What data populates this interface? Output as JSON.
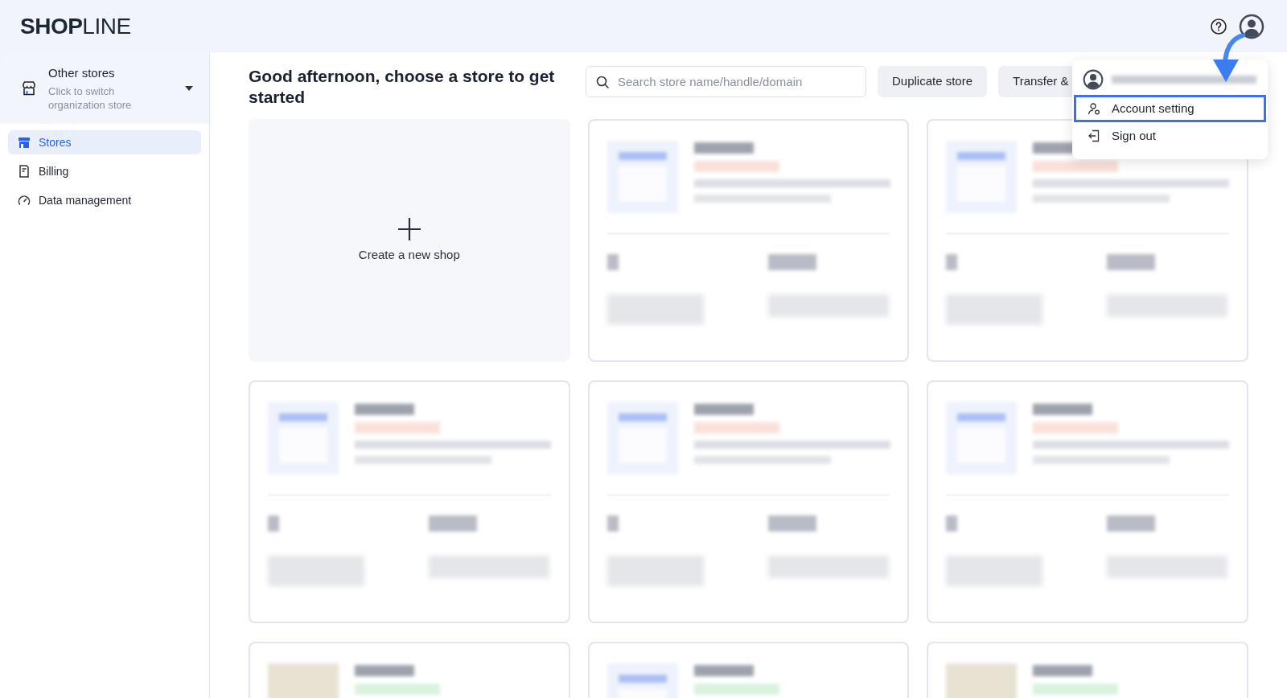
{
  "header": {
    "logo": "**SHOP**LINE"
  },
  "sidebar": {
    "switcher": {
      "title": "Other stores",
      "subtitle": "Click to switch organization store"
    },
    "items": [
      {
        "label": "Stores",
        "kind": "store",
        "selected": true
      },
      {
        "label": "Billing",
        "kind": "billing",
        "selected": false
      },
      {
        "label": "Data management",
        "kind": "gauge",
        "selected": false
      }
    ]
  },
  "main": {
    "greeting": "Good afternoon, choose a store to get started",
    "search": {
      "placeholder": "Search store name/handle/domain"
    },
    "buttons": [
      "Duplicate store",
      "Transfer &"
    ],
    "create_card": {
      "label": "Create a new shop"
    },
    "store_cards": [
      {
        "kind": "store",
        "color": "#fbe0da"
      },
      {
        "kind": "store",
        "color": "#fbe0da"
      },
      {
        "kind": "store",
        "color": "#fbe0da"
      },
      {
        "kind": "store",
        "color": "#fbe0da"
      },
      {
        "kind": "store",
        "color": "#fbe0da"
      },
      {
        "kind": "photo",
        "color": "#d9f3df"
      },
      {
        "kind": "store",
        "color": "#d9f3df"
      },
      {
        "kind": "photo",
        "color": "#d9f3df"
      }
    ]
  },
  "account_menu": {
    "items": [
      {
        "label": "Account setting",
        "kind": "account",
        "highlighted": true
      },
      {
        "label": "Sign out",
        "kind": "signout",
        "highlighted": false
      }
    ]
  }
}
